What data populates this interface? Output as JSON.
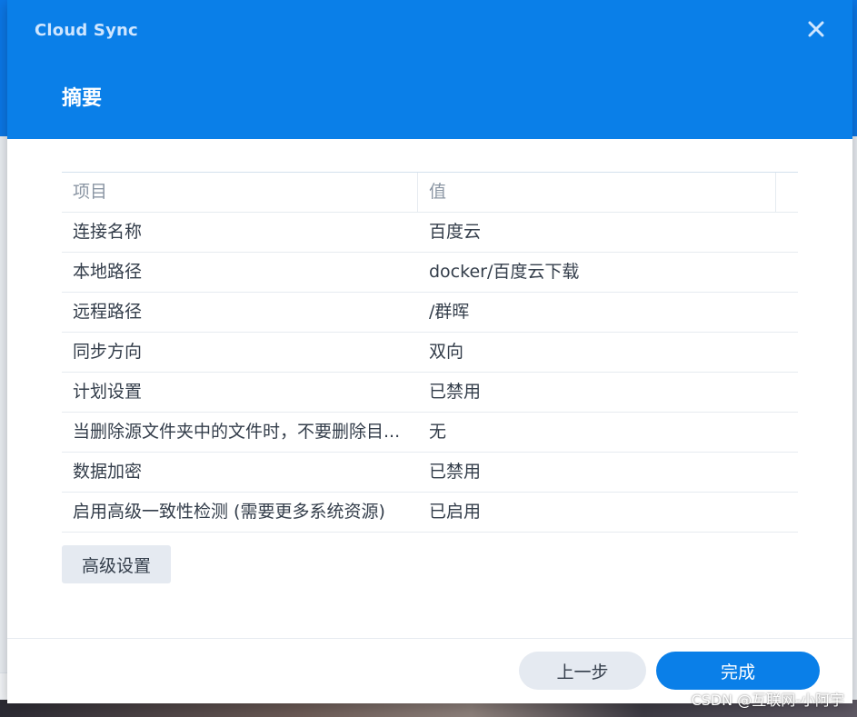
{
  "window": {
    "app_title": "Cloud Sync",
    "step_title": "摘要",
    "close_icon": "close-icon"
  },
  "table": {
    "headers": [
      "项目",
      "值"
    ],
    "rows": [
      {
        "key": "连接名称",
        "value": "百度云"
      },
      {
        "key": "本地路径",
        "value": "docker/百度云下载"
      },
      {
        "key": "远程路径",
        "value": "/群晖"
      },
      {
        "key": "同步方向",
        "value": "双向"
      },
      {
        "key": "计划设置",
        "value": "已禁用"
      },
      {
        "key": "当删除源文件夹中的文件时，不要删除目...",
        "value": "无"
      },
      {
        "key": "数据加密",
        "value": "已禁用"
      },
      {
        "key": "启用高级一致性检测 (需要更多系统资源)",
        "value": "已启用"
      }
    ]
  },
  "buttons": {
    "advanced": "高级设置",
    "previous": "上一步",
    "finish": "完成"
  },
  "watermark": "CSDN @互联网-小阿宇",
  "colors": {
    "accent": "#0a7fe8",
    "secondary_button": "#e5eaf1",
    "text": "#333d4a",
    "header_text": "#8a95a3"
  }
}
